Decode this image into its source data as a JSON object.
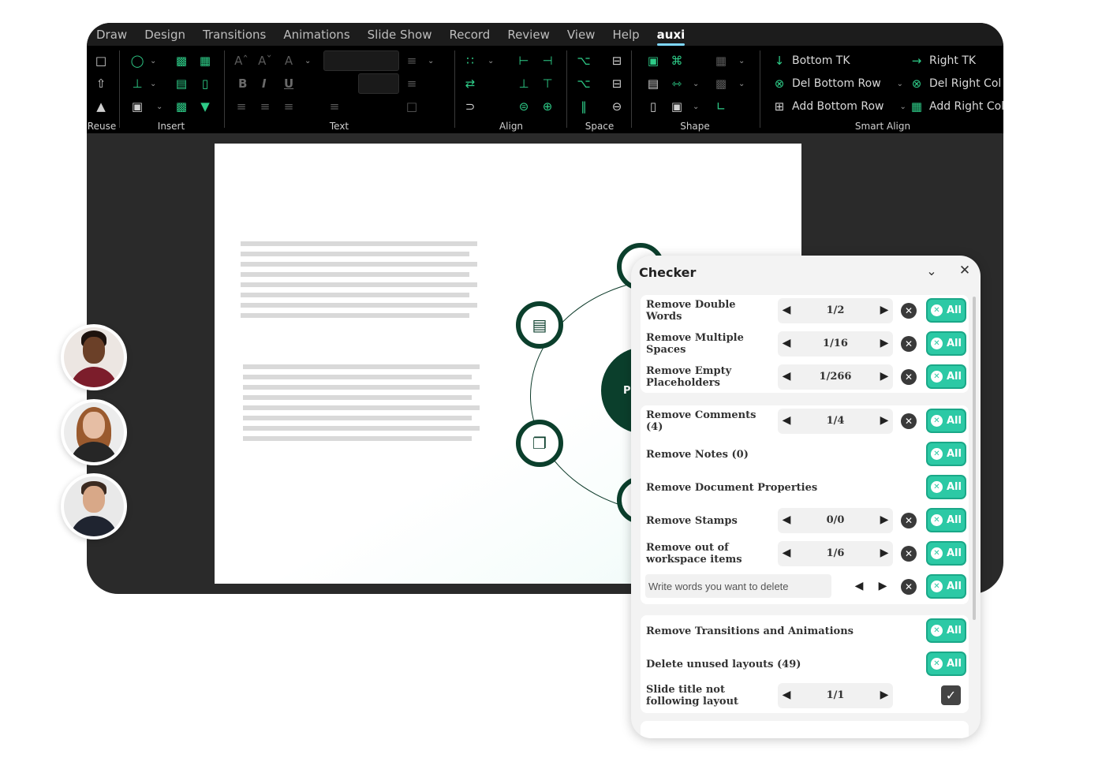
{
  "menu": {
    "items": [
      "Draw",
      "Design",
      "Transitions",
      "Animations",
      "Slide Show",
      "Record",
      "Review",
      "View",
      "Help",
      "auxi"
    ],
    "active_index": 9
  },
  "ribbon": {
    "groups": {
      "reuse": "Reuse",
      "insert": "Insert",
      "text": "Text",
      "align": "Align",
      "space": "Space",
      "shape": "Shape",
      "smart_align": "Smart Align"
    },
    "text_buttons": {
      "bold": "B",
      "italic": "I",
      "underline": "U"
    },
    "smart_align": {
      "bottom_tk": "Bottom TK",
      "right_tk": "Right TK",
      "del_bottom_row": "Del Bottom Row",
      "del_right_col": "Del Right Col",
      "add_bottom_row": "Add Bottom Row",
      "add_right_col": "Add Right Col"
    }
  },
  "slide": {
    "center_label": "P"
  },
  "checker": {
    "title": "Checker",
    "all_label": "All",
    "rows": [
      {
        "label": "Remove Double Words",
        "value": "1/2"
      },
      {
        "label": "Remove Multiple Spaces",
        "value": "1/16"
      },
      {
        "label": "Remove Empty Placeholders",
        "value": "1/266"
      },
      {
        "label": "Remove Comments (4)",
        "value": "1/4"
      },
      {
        "label": "Remove Notes (0)"
      },
      {
        "label": "Remove Document Properties"
      },
      {
        "label": "Remove Stamps",
        "value": "0/0"
      },
      {
        "label": "Remove out of workspace items",
        "value": "1/6"
      },
      {
        "placeholder": "Write words you want to delete"
      },
      {
        "label": "Remove Transitions and Animations"
      },
      {
        "label": "Delete unused layouts (49)"
      },
      {
        "label": "Slide title not following layout",
        "value": "1/1"
      }
    ]
  },
  "colors": {
    "accent_green": "#2ecc88",
    "all_button": "#2cc9a5",
    "slide_node": "#0b3f2c",
    "tab_underline": "#7fd8ff"
  }
}
